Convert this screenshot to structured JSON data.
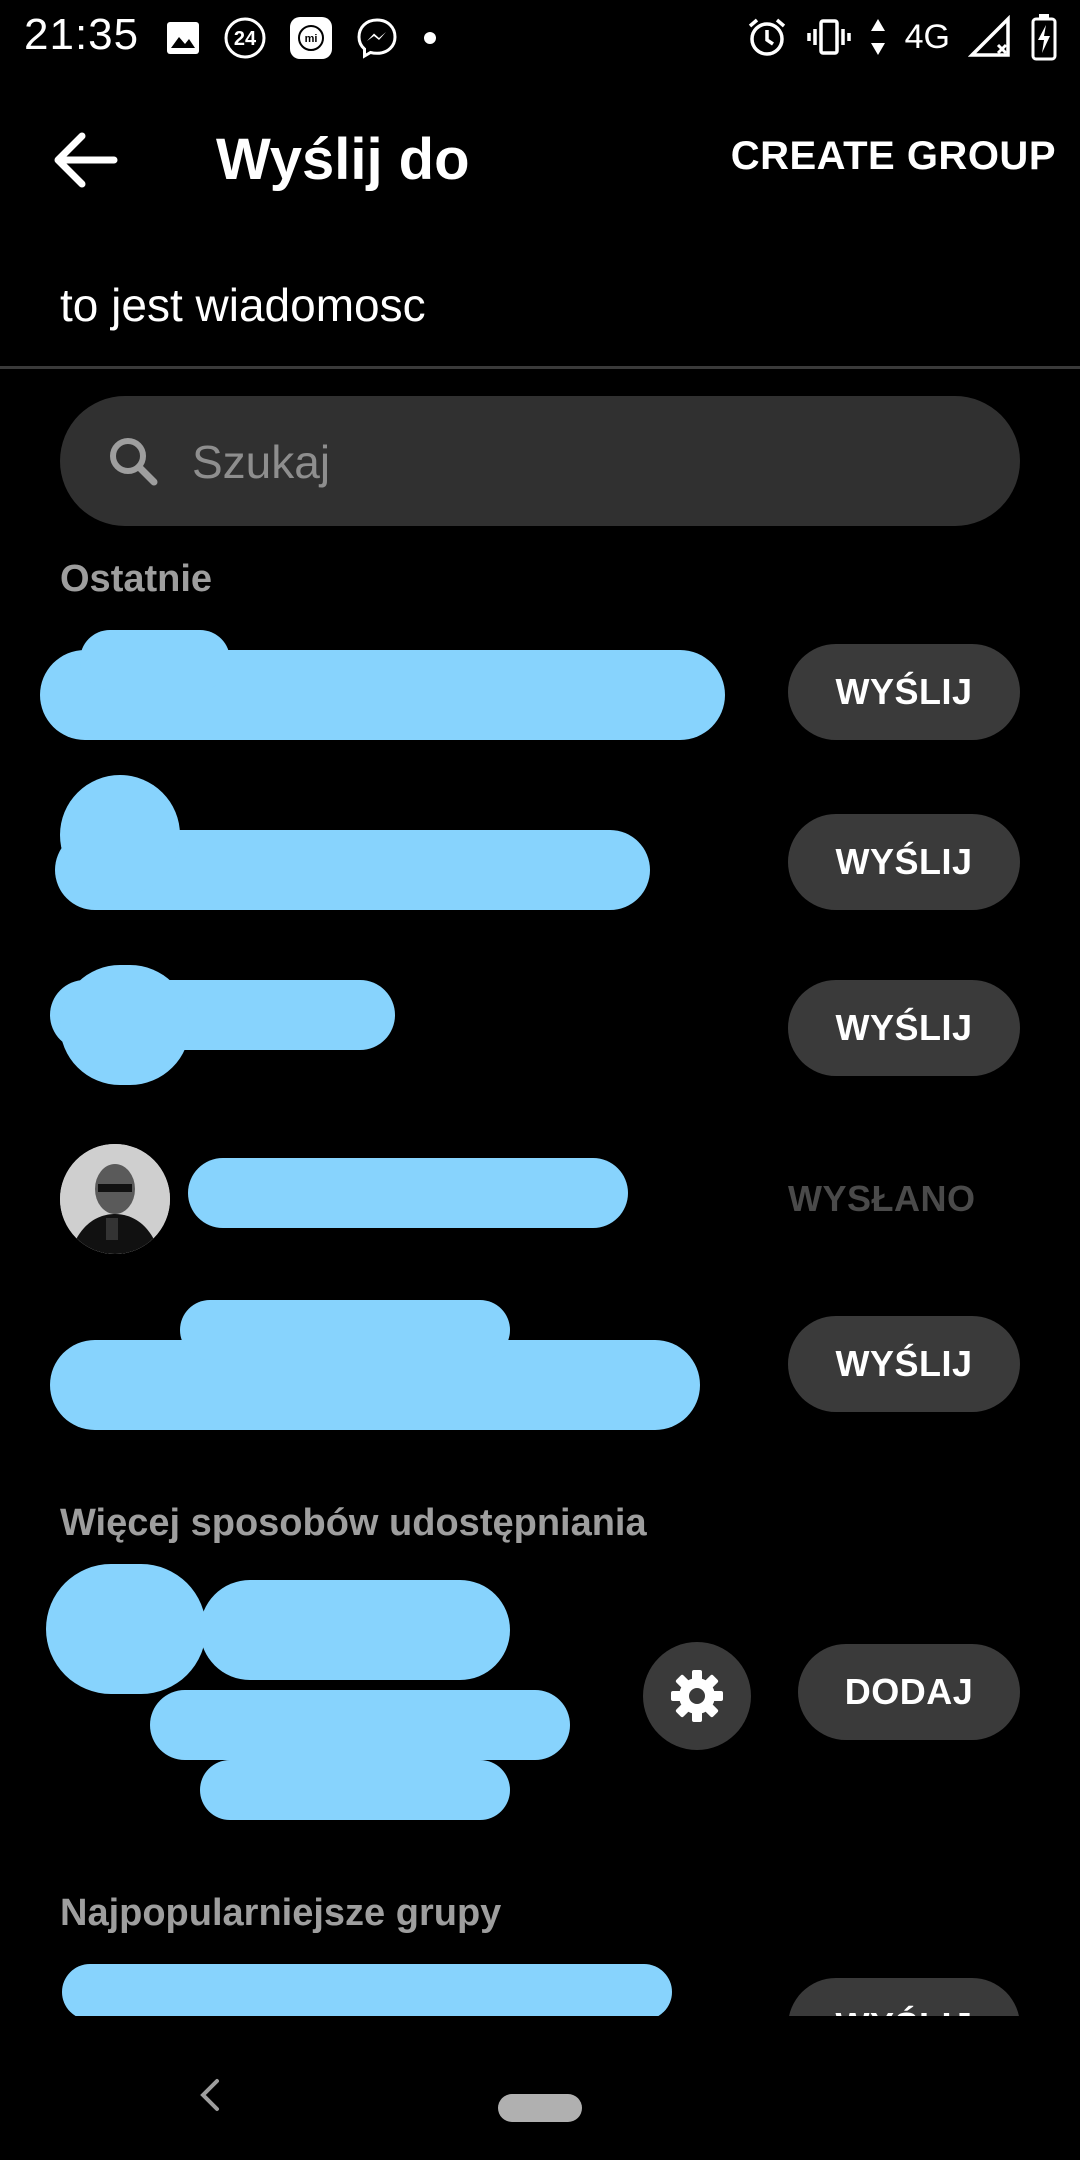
{
  "status_bar": {
    "time": "21:35",
    "notification_icons": [
      "image-icon",
      "24-badge-icon",
      "mi-icon",
      "messenger-icon",
      "dot-icon"
    ],
    "network": "4G",
    "system_icons": [
      "alarm-icon",
      "vibrate-icon",
      "data-arrows-icon",
      "signal-icon",
      "battery-charging-icon"
    ]
  },
  "header": {
    "title": "Wyślij do",
    "action": "CREATE GROUP"
  },
  "message": {
    "text": "to jest wiadomosc"
  },
  "search": {
    "placeholder": "Szukaj"
  },
  "sections": {
    "recent": "Ostatnie",
    "more_ways": "Więcej sposobów udostępniania",
    "popular_groups": "Najpopularniejsze grupy"
  },
  "recent_contacts": [
    {
      "action": "WYŚLIJ",
      "state": "send"
    },
    {
      "action": "WYŚLIJ",
      "state": "send"
    },
    {
      "action": "WYŚLIJ",
      "state": "send"
    },
    {
      "action": "WYSŁANO",
      "state": "sent"
    },
    {
      "action": "WYŚLIJ",
      "state": "send"
    }
  ],
  "more_ways_row": {
    "action": "DODAJ"
  },
  "popular_groups_rows": [
    {
      "action": "WYŚLIJ"
    }
  ],
  "colors": {
    "background": "#000000",
    "button_bg": "#3a3a3a",
    "section_header": "#9e9e9e",
    "redaction": "#87d3fd",
    "sent_text": "#4a4a4a"
  }
}
